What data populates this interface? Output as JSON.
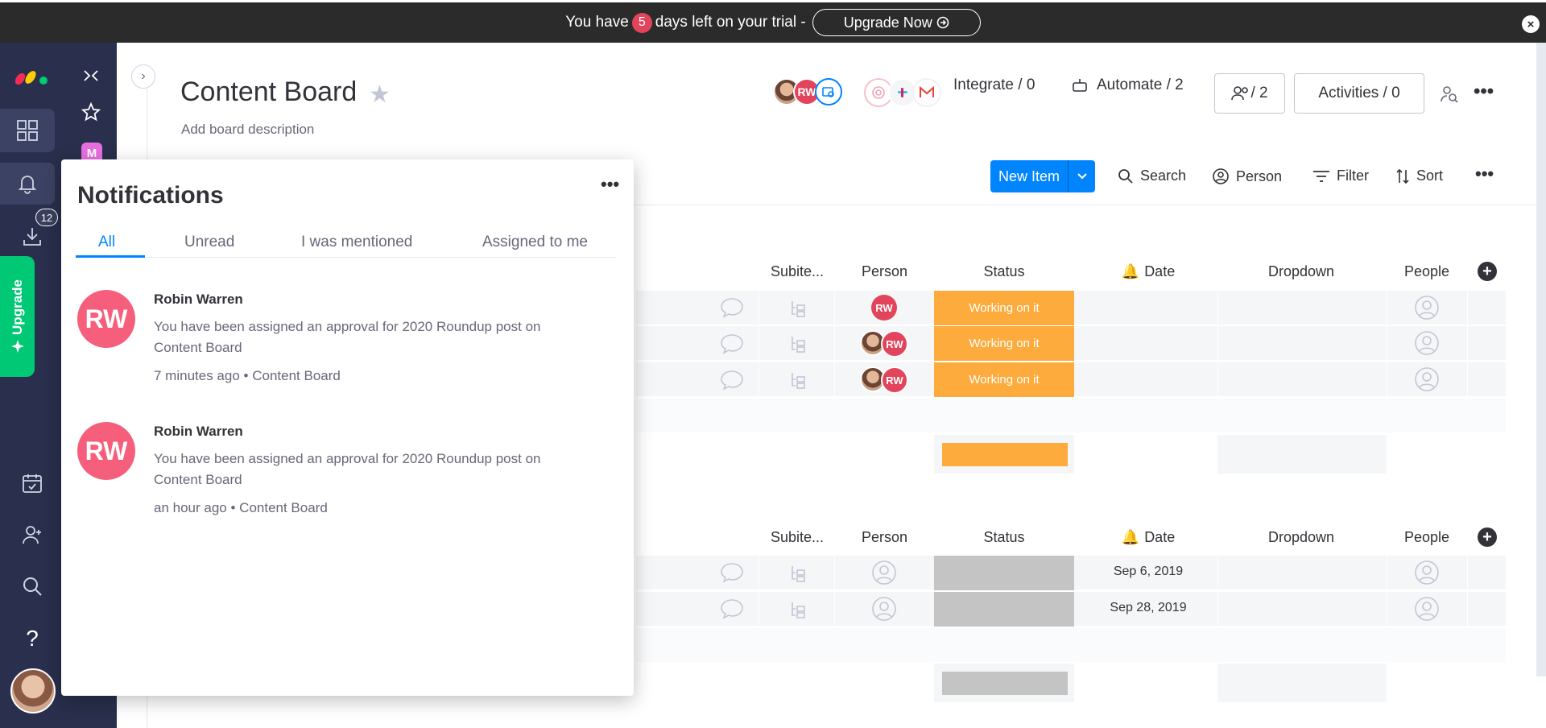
{
  "banner": {
    "prefix": "You have",
    "days": "5",
    "suffix": "days left on your trial -",
    "upgrade_label": "Upgrade Now",
    "close_label": "×"
  },
  "rail": {
    "inbox_badge": "12",
    "upgrade_label": "Upgrade",
    "help_label": "?",
    "workspace_letter": "M"
  },
  "board": {
    "title": "Content Board",
    "description": "Add board description",
    "integrate_label": "Integrate / 0",
    "automate_label": "Automate / 2",
    "members_label": "/ 2",
    "activities_label": "Activities / 0",
    "avatar_initials": "RW",
    "new_item_label": "New Item",
    "search_label": "Search",
    "person_label": "Person",
    "filter_label": "Filter",
    "sort_label": "Sort"
  },
  "table": {
    "columns": [
      "Subite...",
      "Person",
      "Status",
      "Date",
      "Dropdown",
      "People"
    ],
    "group1": {
      "rows": [
        {
          "person": "RW",
          "status": "Working on it"
        },
        {
          "person": "RW",
          "status": "Working on it"
        },
        {
          "person": "RW",
          "status": "Working on it"
        }
      ]
    },
    "group2": {
      "rows": [
        {
          "date": "Sep 6, 2019"
        },
        {
          "date": "Sep 28, 2019"
        }
      ]
    }
  },
  "notifications": {
    "title": "Notifications",
    "tabs": [
      "All",
      "Unread",
      "I was mentioned",
      "Assigned to me"
    ],
    "items": [
      {
        "initials": "RW",
        "name": "Robin Warren",
        "text": "You have been assigned an approval for 2020 Roundup post on Content Board",
        "time": "7 minutes ago",
        "board": "Content Board"
      },
      {
        "initials": "RW",
        "name": "Robin Warren",
        "text": "You have been assigned an approval for 2020 Roundup post on Content Board",
        "time": "an hour ago",
        "board": "Content Board"
      }
    ]
  },
  "colors": {
    "brand_blue": "#0085ff",
    "working_on_it": "#fdab3d",
    "rail_bg": "#292f4c",
    "upgrade_green": "#00c875",
    "avatar_pink": "#f65f7c"
  }
}
